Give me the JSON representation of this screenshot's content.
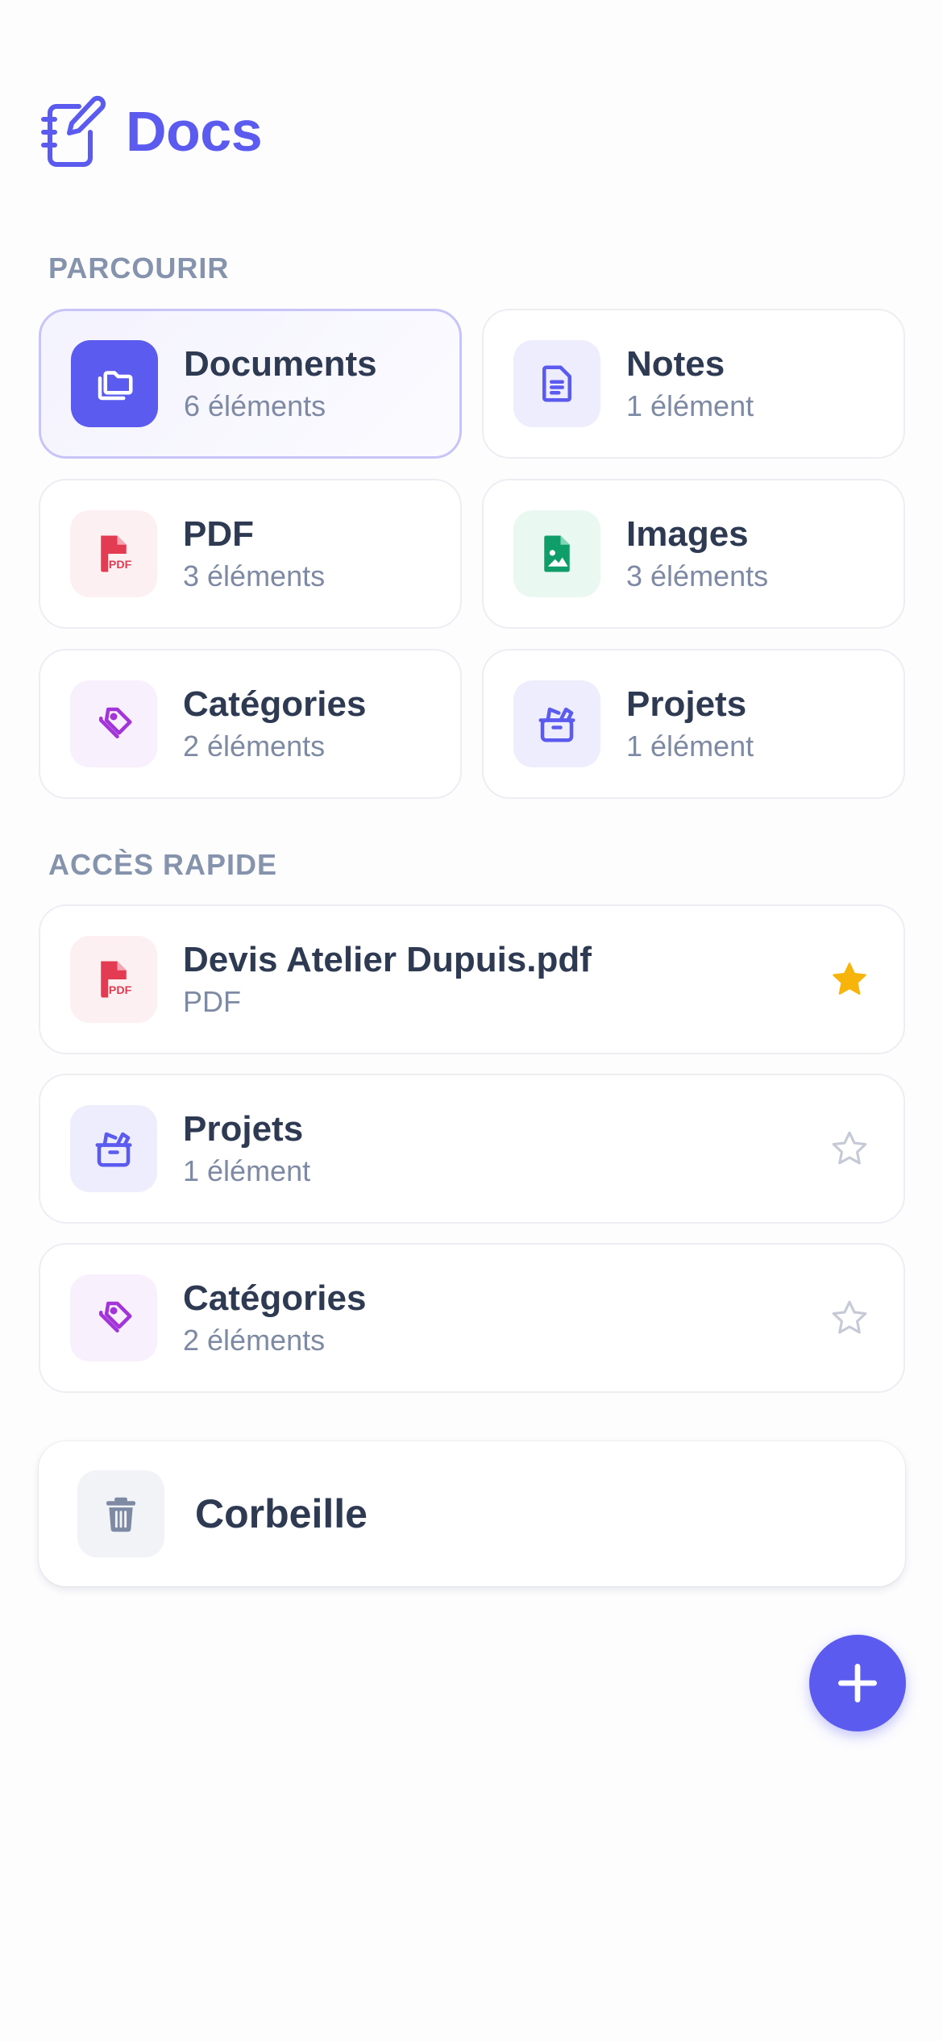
{
  "app": {
    "title": "Docs"
  },
  "browse": {
    "label": "PARCOURIR",
    "items": [
      {
        "title": "Documents",
        "count": "6 éléments",
        "icon": "folders-icon",
        "color": "#5b5bf0",
        "active": true
      },
      {
        "title": "Notes",
        "count": "1 élément",
        "icon": "note-icon",
        "color": "#5b5bf0"
      },
      {
        "title": "PDF",
        "count": "3 éléments",
        "icon": "pdf-icon",
        "color": "#e23b52"
      },
      {
        "title": "Images",
        "count": "3 éléments",
        "icon": "image-file-icon",
        "color": "#0f9d6a"
      },
      {
        "title": "Catégories",
        "count": "2 éléments",
        "icon": "tags-icon",
        "color": "#a234d8"
      },
      {
        "title": "Projets",
        "count": "1 élément",
        "icon": "project-box-icon",
        "color": "#5b5bf0"
      }
    ]
  },
  "quick_access": {
    "label": "ACCÈS RAPIDE",
    "items": [
      {
        "title": "Devis Atelier Dupuis.pdf",
        "subtitle": "PDF",
        "icon": "pdf-icon",
        "starred": true
      },
      {
        "title": "Projets",
        "subtitle": "1 élément",
        "icon": "project-box-icon",
        "starred": false
      },
      {
        "title": "Catégories",
        "subtitle": "2 éléments",
        "icon": "tags-icon",
        "starred": false
      }
    ]
  },
  "trash": {
    "label": "Corbeille",
    "icon": "trash-icon"
  },
  "fab": {
    "icon": "plus-icon"
  },
  "colors": {
    "accent": "#5b5bf0",
    "star": "#f7b50c",
    "pdf": "#e23b52",
    "image": "#0f9d6a",
    "tag": "#a234d8"
  }
}
